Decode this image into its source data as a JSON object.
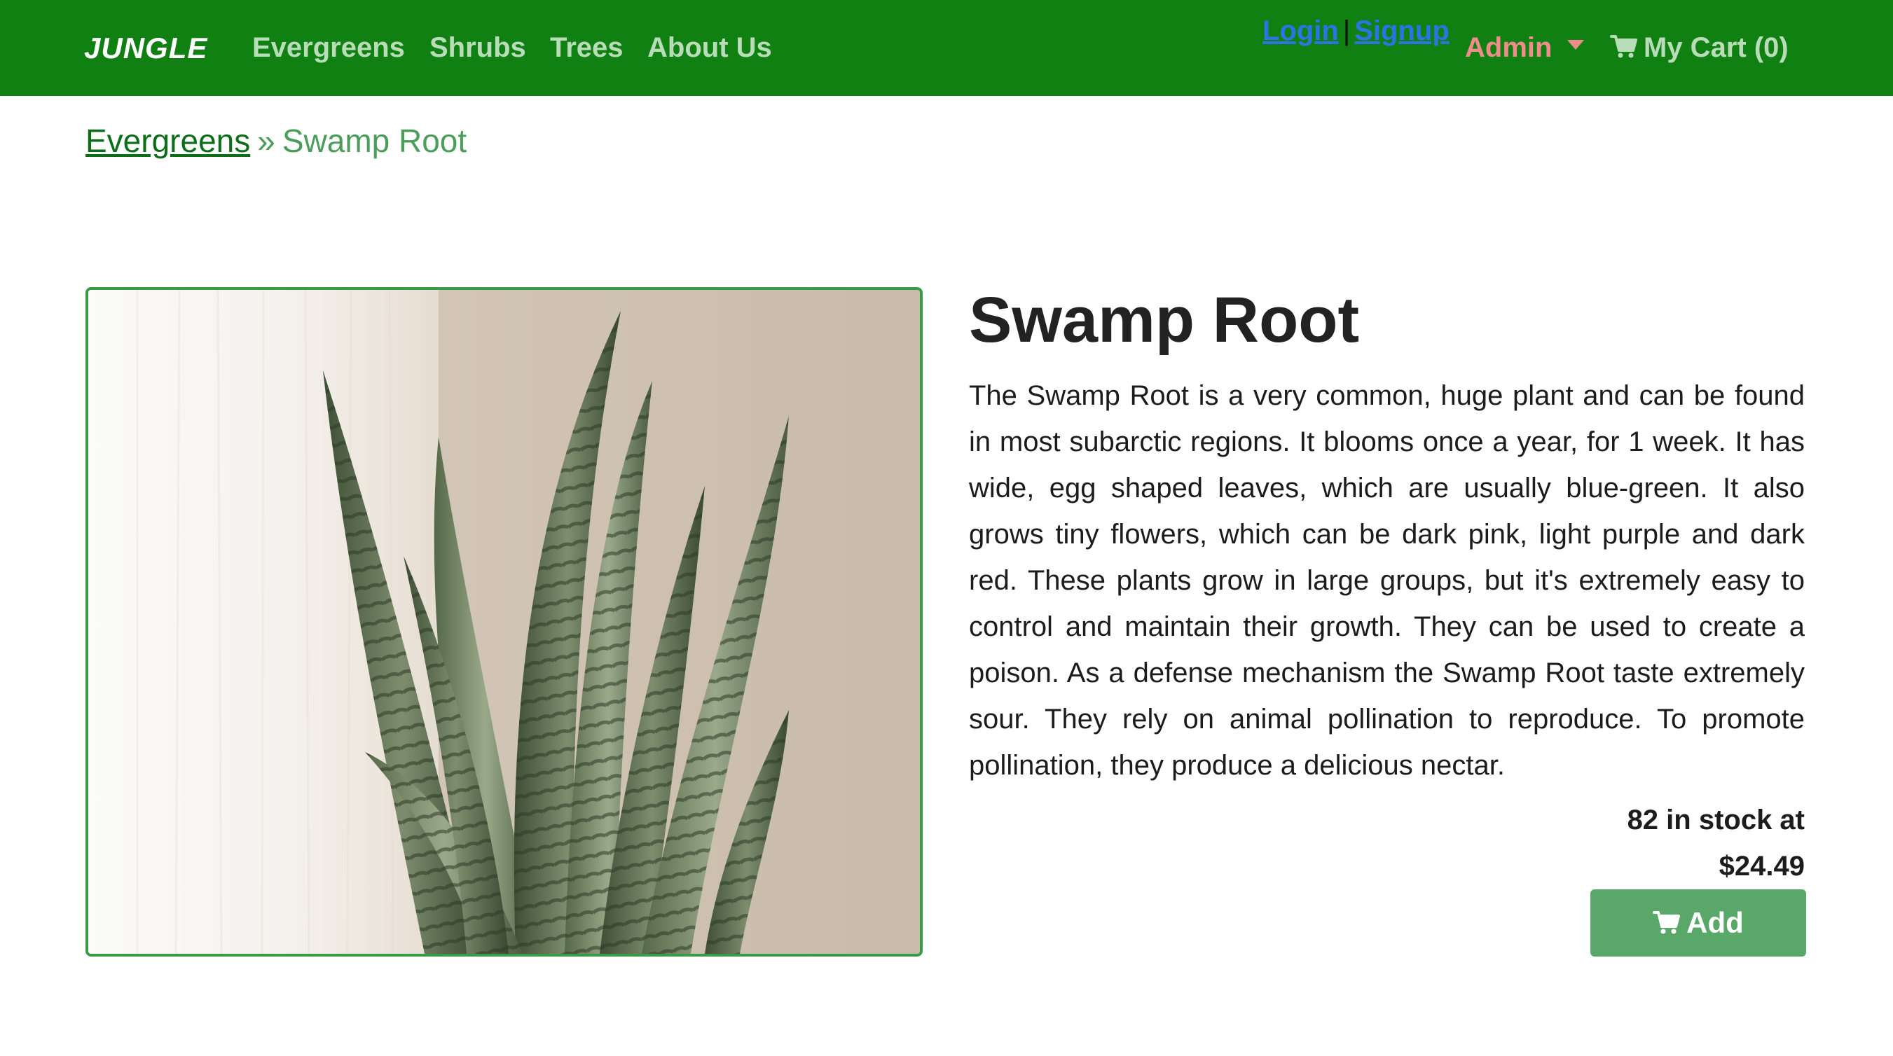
{
  "navbar": {
    "brand": "JUNGLE",
    "links": [
      "Evergreens",
      "Shrubs",
      "Trees",
      "About Us"
    ],
    "login": "Login",
    "separator": "|",
    "signup": "Signup",
    "admin": "Admin",
    "cart": "My Cart (0)",
    "background_color": "#108013",
    "link_color": "#b9dcb9",
    "admin_color": "#f08c8c",
    "auth_link_color": "#2b74e4"
  },
  "breadcrumb": {
    "parent": "Evergreens",
    "separator": "»",
    "current": "Swamp Root"
  },
  "product": {
    "image_icon": "snake-plant-photo",
    "title": "Swamp Root",
    "description": "The Swamp Root is a very common, huge plant and can be found in most subarctic regions. It blooms once a year, for 1 week. It has wide, egg shaped leaves, which are usually blue-green. It also grows tiny flowers, which can be dark pink, light purple and dark red. These plants grow in large groups, but it's extremely easy to control and maintain their growth. They can be used to create a poison. As a defense mechanism the Swamp Root taste extremely sour. They rely on animal pollination to reproduce. To promote pollination, they produce a delicious nectar.",
    "stock_line1": "82 in stock at",
    "price": "$24.49",
    "add_label": "Add",
    "accent_color": "#5aa869"
  }
}
